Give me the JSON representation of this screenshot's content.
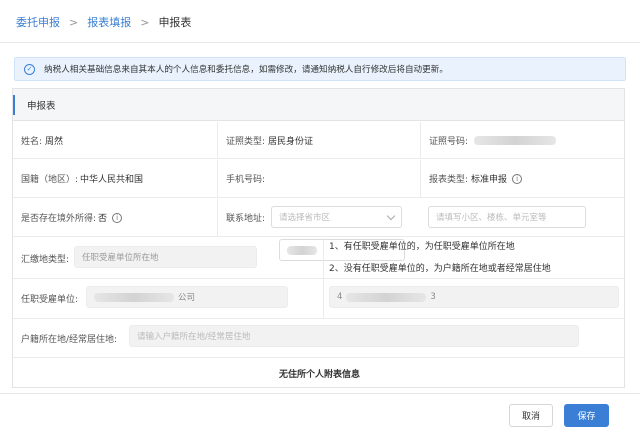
{
  "breadcrumb": {
    "items": [
      "委托申报",
      "报表填报",
      "申报表"
    ],
    "separator": ">"
  },
  "notice": {
    "icon": "check-circle-icon",
    "text": "纳税人相关基础信息来自其本人的个人信息和委托信息，如需修改，请通知纳税人自行修改后将自动更新。"
  },
  "form": {
    "section_title": "申报表",
    "name_label": "姓名:",
    "name_value": "周然",
    "id_type_label": "证照类型:",
    "id_type_value": "居民身份证",
    "id_number_label": "证照号码:",
    "nationality_label": "国籍（地区）:",
    "nationality_value": "中华人民共和国",
    "phone_label": "手机号码:",
    "report_type_label": "报表类型:",
    "report_type_value": "标准申报",
    "overseas_label": "是否存在境外所得:",
    "overseas_value": "否",
    "address_label": "联系地址:",
    "address_select_placeholder": "请选择省市区",
    "address_detail_placeholder": "请填写小区、楼栋、单元室等",
    "filing_place_label": "汇缴地类型:",
    "filing_place_value": "任职受雇单位所在地",
    "note_1": "1、有任职受雇单位的，为任职受雇单位所在地",
    "note_2": "2、没有任职受雇单位的，为户籍所在地或者经常居住地",
    "employer_label": "任职受雇单位:",
    "employer_suffix": "公司",
    "employer_code_prefix": "4",
    "employer_code_suffix": "3",
    "residence_label": "户籍所在地/经常居住地:",
    "residence_placeholder": "请输入户籍所在地/经常居住地",
    "no_residence_title": "无住所个人附表信息"
  },
  "actions": {
    "cancel_label": "取消",
    "save_label": "保存"
  },
  "colors": {
    "accent": "#3a7fd5",
    "notice_bg": "#eaf3fd"
  }
}
